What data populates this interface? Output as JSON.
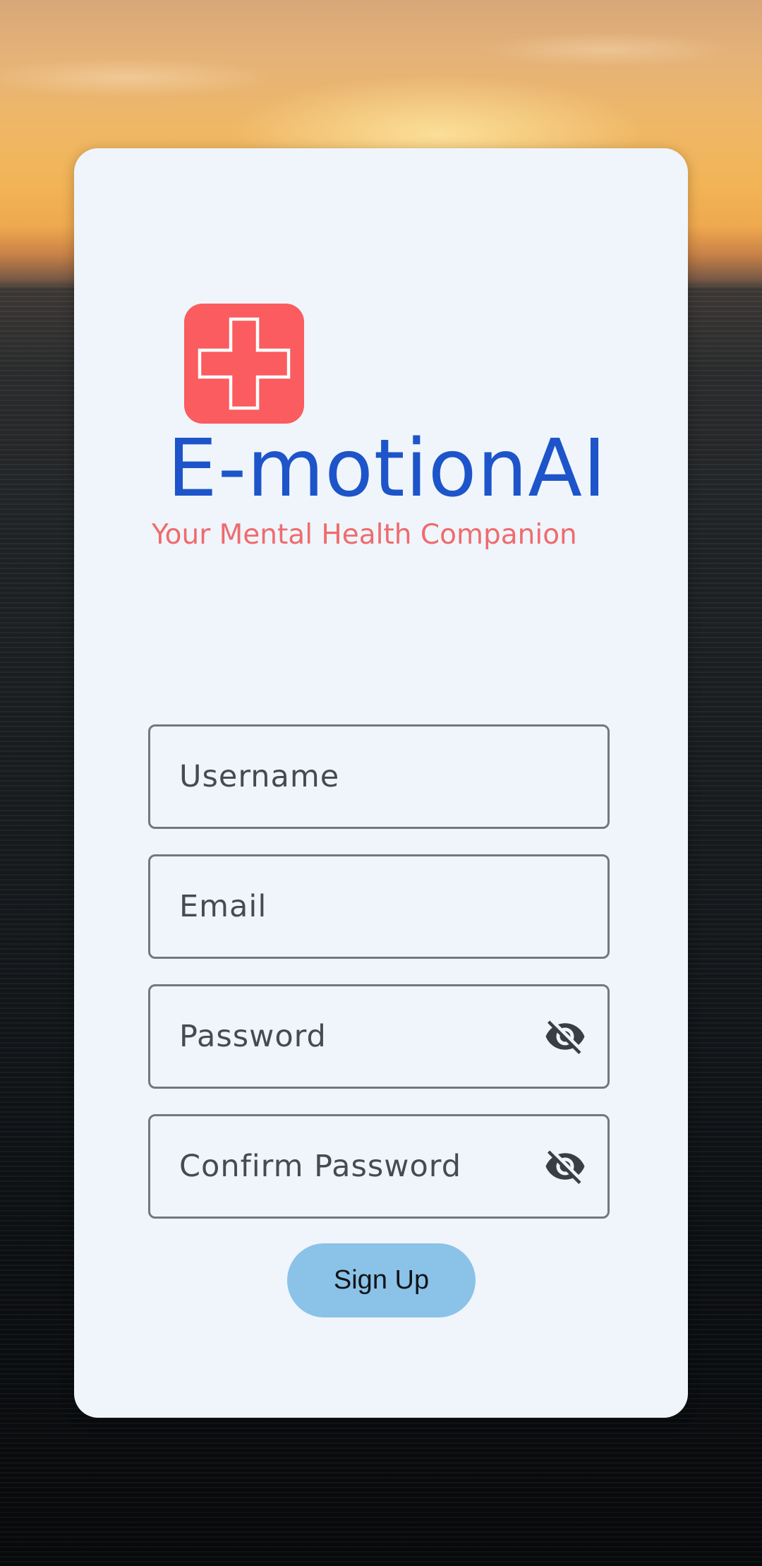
{
  "app": {
    "brand_name": "E-motionAI",
    "tagline": "Your Mental Health Companion",
    "logo_icon": "medical-cross-icon",
    "colors": {
      "brand_blue": "#1d54c9",
      "logo_red": "#fa5c5f",
      "tagline_red": "#ef6b6e",
      "card_bg": "#eff5fb",
      "button_bg": "#8bc2e8"
    }
  },
  "form": {
    "username": {
      "placeholder": "Username",
      "value": ""
    },
    "email": {
      "placeholder": "Email",
      "value": ""
    },
    "password": {
      "placeholder": "Password",
      "value": "",
      "toggle_icon": "visibility-off-icon"
    },
    "confirm_password": {
      "placeholder": "Confirm Password",
      "value": "",
      "toggle_icon": "visibility-off-icon"
    },
    "submit_label": "Sign Up"
  }
}
